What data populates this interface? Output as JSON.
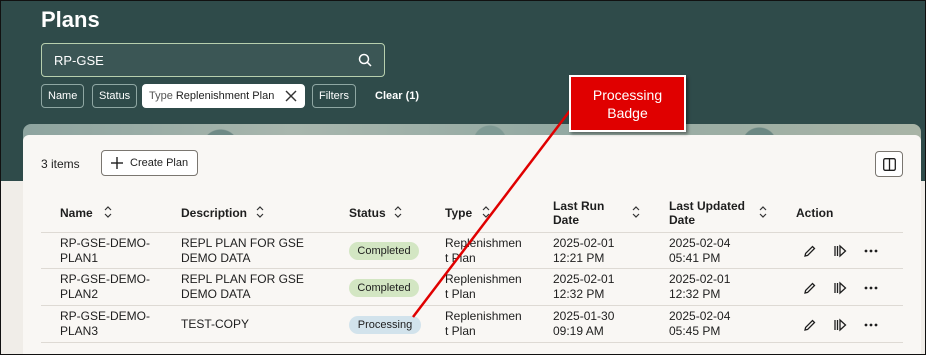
{
  "page": {
    "title": "Plans"
  },
  "search": {
    "value": "RP-GSE"
  },
  "filters": {
    "name_label": "Name",
    "status_label": "Status",
    "type_chip_prefix": "Type",
    "type_chip_value": "Replenishment Plan",
    "filters_label": "Filters",
    "clear_label": "Clear (1)"
  },
  "toolbar": {
    "count": "3 items",
    "create_label": "Create Plan"
  },
  "table": {
    "headers": {
      "name": "Name",
      "description": "Description",
      "status": "Status",
      "type": "Type",
      "last_run_1": "Last Run",
      "last_run_2": "Date",
      "last_updated_1": "Last Updated",
      "last_updated_2": "Date",
      "action": "Action"
    },
    "rows": [
      {
        "name1": "RP-GSE-DEMO-",
        "name2": "PLAN1",
        "desc1": "REPL PLAN FOR GSE",
        "desc2": "DEMO DATA",
        "status": "Completed",
        "type1": "Replenishmen",
        "type2": "t Plan",
        "run1": "2025-02-01",
        "run2": "12:21 PM",
        "upd1": "2025-02-04",
        "upd2": "05:41 PM"
      },
      {
        "name1": "RP-GSE-DEMO-",
        "name2": "PLAN2",
        "desc1": "REPL PLAN FOR GSE",
        "desc2": "DEMO DATA",
        "status": "Completed",
        "type1": "Replenishmen",
        "type2": "t Plan",
        "run1": "2025-02-01",
        "run2": "12:32 PM",
        "upd1": "2025-02-01",
        "upd2": "12:32 PM"
      },
      {
        "name1": "RP-GSE-DEMO-",
        "name2": "PLAN3",
        "desc1": "TEST-COPY",
        "desc2": "",
        "status": "Processing",
        "type1": "Replenishmen",
        "type2": "t Plan",
        "run1": "2025-01-30",
        "run2": "09:19 AM",
        "upd1": "2025-02-04",
        "upd2": "05:45 PM"
      }
    ]
  },
  "callout": {
    "line1": "Processing",
    "line2": "Badge"
  },
  "colors": {
    "header_bg": "#2f4b4a",
    "completed_badge": "#d3e6c3",
    "processing_badge": "#d2e3ec",
    "callout": "#e00000"
  },
  "icons": [
    "search-icon",
    "close-icon",
    "plus-icon",
    "panel-toggle-icon",
    "sort-icon",
    "edit-icon",
    "run-icon",
    "more-icon"
  ]
}
